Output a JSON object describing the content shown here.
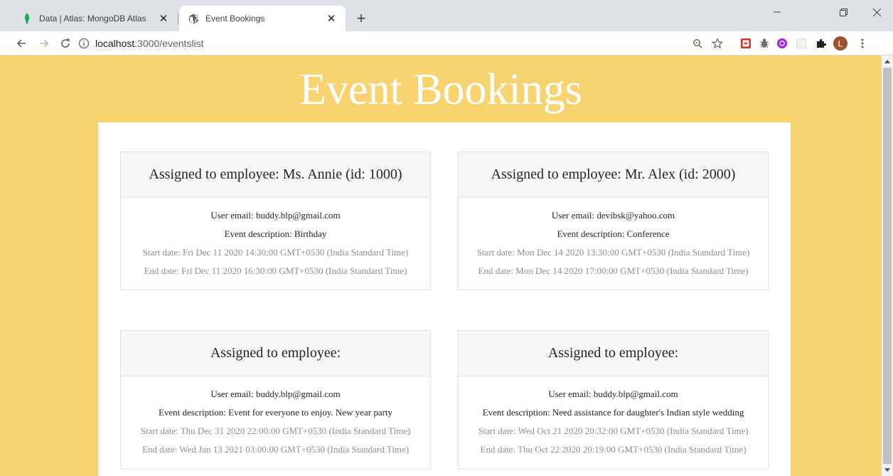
{
  "browser": {
    "tabs": [
      {
        "title": "Data | Atlas: MongoDB Atlas",
        "icon": "mongodb-leaf-icon",
        "active": false
      },
      {
        "title": "Event Bookings",
        "icon": "globe-icon",
        "active": true
      }
    ],
    "close_glyph": "✕",
    "new_tab_glyph": "+",
    "url_host": "localhost",
    "url_path": ":3000/eventslist",
    "profile_initial": "L"
  },
  "page": {
    "title": "Event Bookings"
  },
  "events": [
    {
      "header": "Assigned to employee: Ms. Annie (id: 1000)",
      "email": "User email: buddy.blp@gmail.com",
      "description": "Event description: Birthday",
      "start": "Start date: Fri Dec 11 2020 14:30:00 GMT+0530 (India Standard Time)",
      "end": "End date: Fri Dec 11 2020 16:30:00 GMT+0530 (India Standard Time)"
    },
    {
      "header": "Assigned to employee: Mr. Alex (id: 2000)",
      "email": "User email: devibsk@yahoo.com",
      "description": "Event description: Conference",
      "start": "Start date: Mon Dec 14 2020 13:30:00 GMT+0530 (India Standard Time)",
      "end": "End date: Mon Dec 14 2020 17:00:00 GMT+0530 (India Standard Time)"
    },
    {
      "header": "Assigned to employee:",
      "email": "User email: buddy.blp@gmail.com",
      "description": "Event description: Event for everyone to enjoy. New year party",
      "start": "Start date: Thu Dec 31 2020 22:00:00 GMT+0530 (India Standard Time)",
      "end": "End date: Wed Jan 13 2021 03:00:00 GMT+0530 (India Standard Time)"
    },
    {
      "header": "Assigned to employee:",
      "email": "User email: buddy.blp@gmail.com",
      "description": "Event description: Need assistance for daughter's Indian style wedding",
      "start": "Start date: Wed Oct 21 2020 20:32:00 GMT+0530 (India Standard Time)",
      "end": "End date: Thu Oct 22 2020 20:19:00 GMT+0530 (India Standard Time)"
    }
  ],
  "colors": {
    "page_background": "#f7d46f",
    "title_color": "#ffffff",
    "card_header_bg": "#f7f7f7",
    "muted_text": "#8a8f94",
    "profile_avatar": "#a0522d"
  }
}
